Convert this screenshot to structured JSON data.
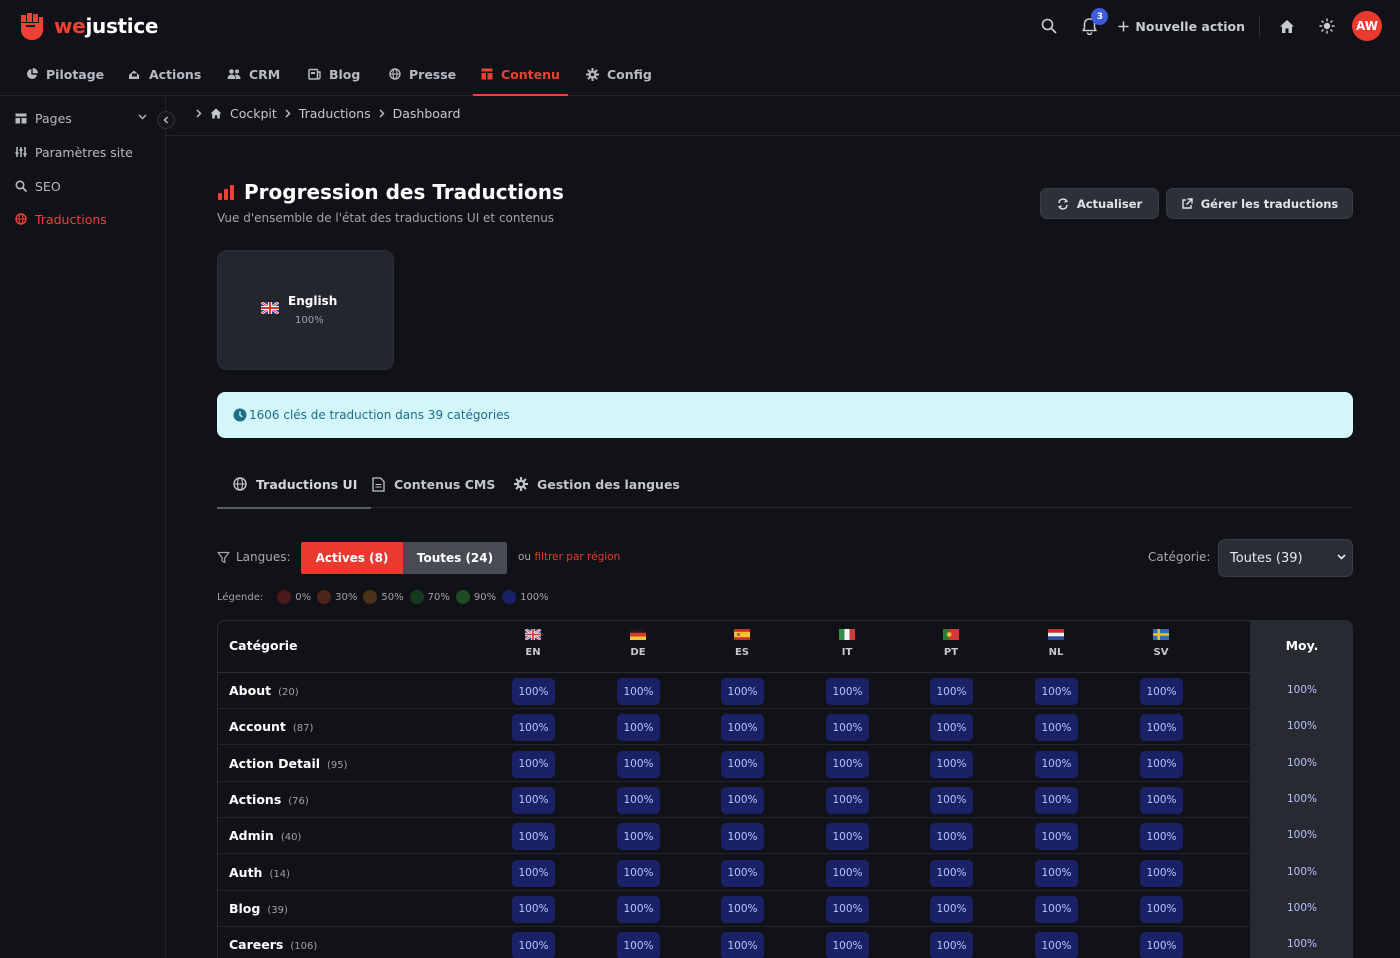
{
  "brand": {
    "prefix": "we",
    "suffix": "justice"
  },
  "topbar": {
    "notification_count": "3",
    "new_action_label": "Nouvelle action",
    "avatar_initials": "AW"
  },
  "nav": [
    "Pilotage",
    "Actions",
    "CRM",
    "Blog",
    "Presse",
    "Contenu",
    "Config"
  ],
  "sidebar": [
    "Pages",
    "Paramètres site",
    "SEO",
    "Traductions"
  ],
  "breadcrumb": [
    "Cockpit",
    "Traductions",
    "Dashboard"
  ],
  "header": {
    "title": "Progression des Traductions",
    "subtitle": "Vue d'ensemble de l'état des traductions UI et contenus",
    "refresh_label": "Actualiser",
    "manage_label": "Gérer les traductions"
  },
  "language_card": {
    "name": "English",
    "percent": "100%"
  },
  "info": {
    "text": "1606 clés de traduction dans 39 catégories"
  },
  "tabs": [
    "Traductions UI",
    "Contenus CMS",
    "Gestion des langues"
  ],
  "filters": {
    "languages_label": "Langues:",
    "active_label": "Actives (8)",
    "all_label": "Toutes (24)",
    "or_text": "ou",
    "region_link": "filtrer par région",
    "category_label": "Catégorie:",
    "category_value": "Toutes (39)"
  },
  "legend": {
    "label": "Légende:",
    "items": [
      {
        "label": "0%",
        "color": "#4a1a1a"
      },
      {
        "label": "30%",
        "color": "#4d2418"
      },
      {
        "label": "50%",
        "color": "#4a3216"
      },
      {
        "label": "70%",
        "color": "#173a1f"
      },
      {
        "label": "90%",
        "color": "#1d4a24"
      },
      {
        "label": "100%",
        "color": "#1b2166"
      }
    ]
  },
  "table": {
    "category_header": "Catégorie",
    "average_header": "Moy.",
    "languages": [
      "EN",
      "DE",
      "ES",
      "IT",
      "PT",
      "NL",
      "SV"
    ],
    "rows": [
      {
        "name": "About",
        "count": "(20)",
        "values": [
          "100%",
          "100%",
          "100%",
          "100%",
          "100%",
          "100%",
          "100%"
        ],
        "avg": "100%"
      },
      {
        "name": "Account",
        "count": "(87)",
        "values": [
          "100%",
          "100%",
          "100%",
          "100%",
          "100%",
          "100%",
          "100%"
        ],
        "avg": "100%"
      },
      {
        "name": "Action Detail",
        "count": "(95)",
        "values": [
          "100%",
          "100%",
          "100%",
          "100%",
          "100%",
          "100%",
          "100%"
        ],
        "avg": "100%"
      },
      {
        "name": "Actions",
        "count": "(76)",
        "values": [
          "100%",
          "100%",
          "100%",
          "100%",
          "100%",
          "100%",
          "100%"
        ],
        "avg": "100%"
      },
      {
        "name": "Admin",
        "count": "(40)",
        "values": [
          "100%",
          "100%",
          "100%",
          "100%",
          "100%",
          "100%",
          "100%"
        ],
        "avg": "100%"
      },
      {
        "name": "Auth",
        "count": "(14)",
        "values": [
          "100%",
          "100%",
          "100%",
          "100%",
          "100%",
          "100%",
          "100%"
        ],
        "avg": "100%"
      },
      {
        "name": "Blog",
        "count": "(39)",
        "values": [
          "100%",
          "100%",
          "100%",
          "100%",
          "100%",
          "100%",
          "100%"
        ],
        "avg": "100%"
      },
      {
        "name": "Careers",
        "count": "(106)",
        "values": [
          "100%",
          "100%",
          "100%",
          "100%",
          "100%",
          "100%",
          "100%"
        ],
        "avg": "100%"
      }
    ]
  },
  "colors": {
    "accent": "#ef4035",
    "pill_bg": "#1b2166",
    "pill_text": "#b8c3ff",
    "info_bg": "#d3f6fb"
  }
}
